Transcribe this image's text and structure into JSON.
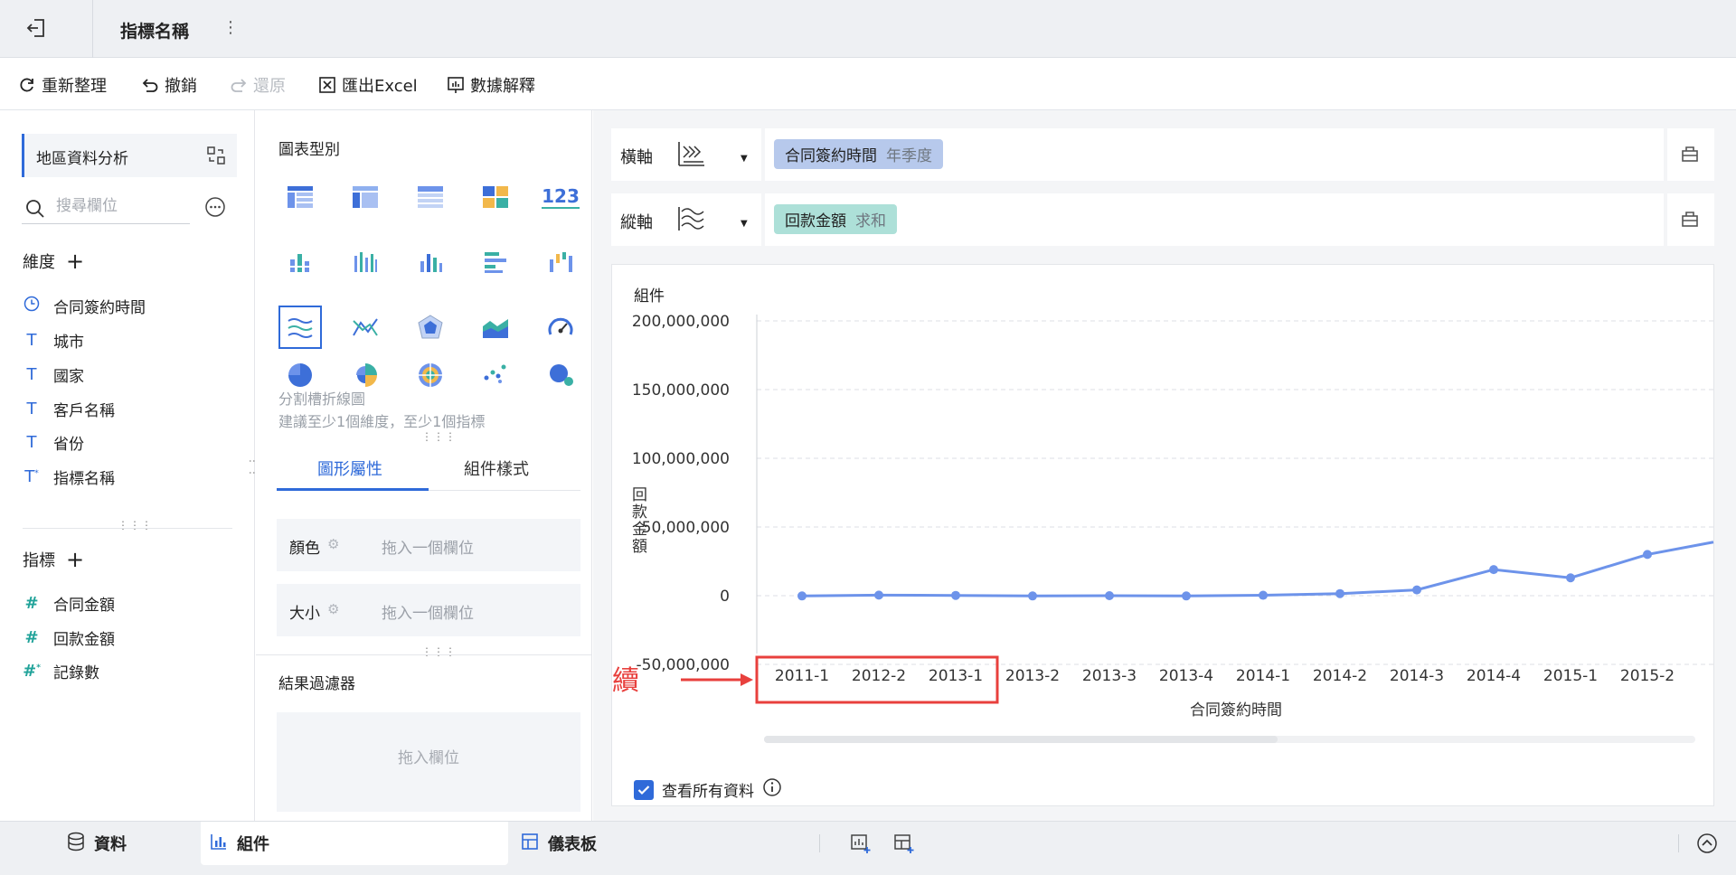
{
  "topbar": {
    "title": "指標名稱",
    "more": "⋮"
  },
  "toolbar": {
    "refresh": "重新整理",
    "undo": "撤銷",
    "redo": "還原",
    "export": "匯出Excel",
    "explain": "數據解釋"
  },
  "left": {
    "dataset": "地區資料分析",
    "search_placeholder": "搜尋欄位",
    "dimensions_title": "維度",
    "dimensions": [
      "合同簽約時間",
      "城市",
      "國家",
      "客戶名稱",
      "省份",
      "指標名稱"
    ],
    "measures_title": "指標",
    "measures": [
      "合同金額",
      "回款金額",
      "記錄數"
    ]
  },
  "mid": {
    "chart_type_title": "圖表型別",
    "selected_chart_name": "分割槽折線圖",
    "hint": "建議至少1個維度，至少1個指標",
    "tabs": [
      "圖形屬性",
      "組件樣式"
    ],
    "props": [
      {
        "label": "顏色",
        "placeholder": "拖入一個欄位"
      },
      {
        "label": "大小",
        "placeholder": "拖入一個欄位"
      }
    ],
    "filter_title": "結果過濾器",
    "filter_placeholder": "拖入欄位"
  },
  "axes": {
    "x_label": "橫軸",
    "x_field": "合同簽約時間",
    "x_sub": "年季度",
    "y_label": "縱軸",
    "y_field": "回款金額",
    "y_sub": "求和"
  },
  "card": {
    "title": "組件",
    "show_all": "查看所有資料"
  },
  "annotation": {
    "text": "時間不連續",
    "color": "#e8403d"
  },
  "colors": {
    "accent": "#2f6ad9",
    "line": "#6d93ea"
  },
  "chart_data": {
    "type": "line",
    "categories": [
      "2011-1",
      "2012-2",
      "2013-1",
      "2013-2",
      "2013-3",
      "2013-4",
      "2014-1",
      "2014-2",
      "2014-3",
      "2014-4",
      "2015-1",
      "2015-2"
    ],
    "series": [
      {
        "values": [
          -200000,
          400000,
          200000,
          -200000,
          0,
          -200000,
          300000,
          1500000,
          4200000,
          19000000,
          13000000,
          30000000
        ]
      }
    ],
    "trailing_value": 39000000,
    "ylabel": "回款金額",
    "xlabel": "合同簽約時間",
    "yticks": [
      "200,000,000",
      "150,000,000",
      "100,000,000",
      "50,000,000",
      "0",
      "-50,000,000"
    ],
    "ytick_values": [
      200000000,
      150000000,
      100000000,
      50000000,
      0,
      -50000000
    ],
    "ylim": [
      -50000000,
      200000000
    ]
  },
  "bottom": {
    "data_tab": "資料",
    "component_tab": "組件",
    "dashboard_tab": "儀表板"
  }
}
